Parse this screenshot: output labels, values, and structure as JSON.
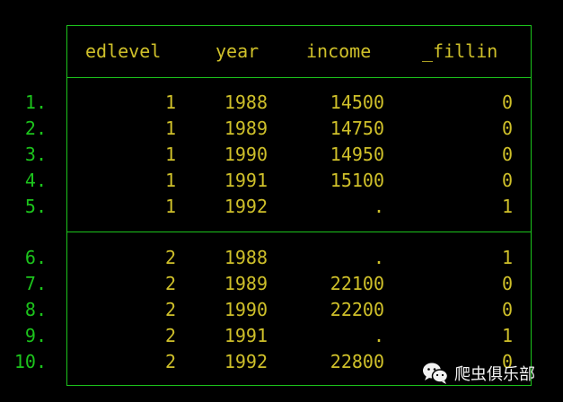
{
  "table": {
    "headers": [
      "edlevel",
      "year",
      "income",
      "_fillin"
    ],
    "rows": [
      {
        "num": "1.",
        "edlevel": "1",
        "year": "1988",
        "income": "14500",
        "fillin": "0"
      },
      {
        "num": "2.",
        "edlevel": "1",
        "year": "1989",
        "income": "14750",
        "fillin": "0"
      },
      {
        "num": "3.",
        "edlevel": "1",
        "year": "1990",
        "income": "14950",
        "fillin": "0"
      },
      {
        "num": "4.",
        "edlevel": "1",
        "year": "1991",
        "income": "15100",
        "fillin": "0"
      },
      {
        "num": "5.",
        "edlevel": "1",
        "year": "1992",
        "income": ".",
        "fillin": "1"
      },
      {
        "num": "6.",
        "edlevel": "2",
        "year": "1988",
        "income": ".",
        "fillin": "1"
      },
      {
        "num": "7.",
        "edlevel": "2",
        "year": "1989",
        "income": "22100",
        "fillin": "0"
      },
      {
        "num": "8.",
        "edlevel": "2",
        "year": "1990",
        "income": "22200",
        "fillin": "0"
      },
      {
        "num": "9.",
        "edlevel": "2",
        "year": "1991",
        "income": ".",
        "fillin": "1"
      },
      {
        "num": "10.",
        "edlevel": "2",
        "year": "1992",
        "income": "22800",
        "fillin": "0"
      }
    ]
  },
  "watermark": {
    "text": "爬虫俱乐部",
    "icon": "wechat-icon"
  },
  "colors": {
    "background": "#000000",
    "border": "#1cc41c",
    "values": "#cfc02a",
    "row_numbers": "#1cc41c",
    "watermark_text": "#f2f2f2"
  }
}
